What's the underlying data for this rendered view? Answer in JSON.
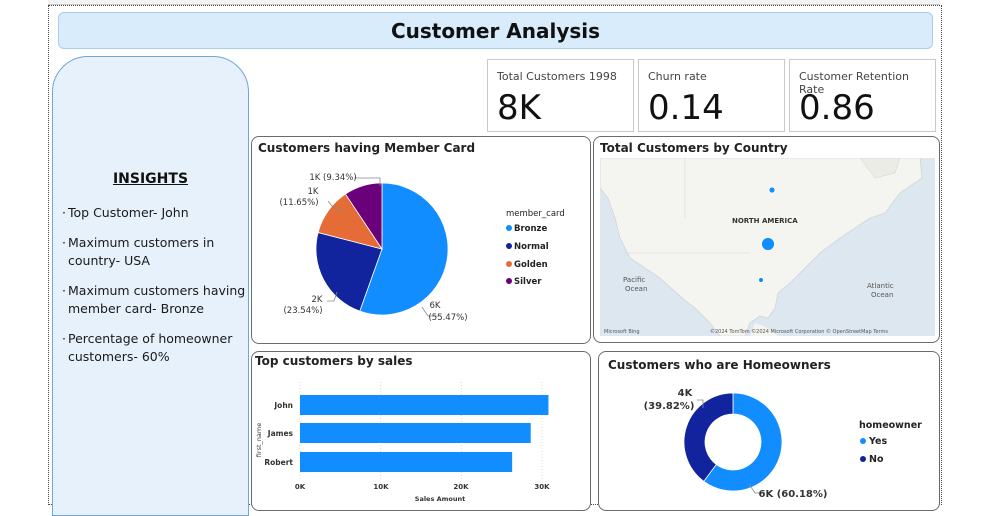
{
  "header": {
    "title": "Customer Analysis"
  },
  "insights": {
    "title": "INSIGHTS",
    "items": [
      "Top Customer- John",
      "Maximum customers in country- USA",
      "Maximum customers having member card- Bronze",
      "Percentage of homeowner customers- 60%"
    ]
  },
  "kpis": [
    {
      "label": "Total Customers 1998",
      "value": "8K"
    },
    {
      "label": "Churn rate",
      "value": "0.14"
    },
    {
      "label": "Customer Retention Rate",
      "value": "0.86"
    }
  ],
  "member_card_chart": {
    "title": "Customers having Member Card",
    "legend_title": "member_card",
    "legend": [
      "Bronze",
      "Normal",
      "Golden",
      "Silver"
    ],
    "labels": {
      "bronze": [
        "6K",
        "(55.47%)"
      ],
      "normal": [
        "2K",
        "(23.54%)"
      ],
      "golden": [
        "1K",
        "(11.65%)"
      ],
      "silver": [
        "1K (9.34%)"
      ]
    }
  },
  "map_card": {
    "title": "Total Customers by Country",
    "labels": {
      "continent": "NORTH AMERICA",
      "pacific": "Pacific",
      "pacific2": "Ocean",
      "atlantic": "Atlantic",
      "atlantic2": "Ocean"
    },
    "footer": {
      "brand": "Microsoft Bing",
      "copyright": "©2024 TomTom ©2024 Microsoft Corporation © OpenStreetMap Terms"
    }
  },
  "sales_chart": {
    "title": "Top customers by sales",
    "ylabel": "first_name",
    "xlabel": "Sales Amount",
    "ticks": [
      "0K",
      "10K",
      "20K",
      "30K"
    ]
  },
  "homeowner_chart": {
    "title": "Customers who are Homeowners",
    "legend_title": "homeowner",
    "legend": [
      "Yes",
      "No"
    ],
    "labels": {
      "no": [
        "4K",
        "(39.82%)"
      ],
      "yes": [
        "6K (60.18%)"
      ]
    }
  },
  "colors": {
    "bronze": "#118DFF",
    "normal": "#12239E",
    "golden": "#E66C37",
    "silver": "#6B007B",
    "bar": "#118DFF"
  },
  "chart_data": [
    {
      "type": "pie",
      "title": "Customers having Member Card",
      "legend_title": "member_card",
      "categories": [
        "Bronze",
        "Normal",
        "Golden",
        "Silver"
      ],
      "values": [
        55.47,
        23.54,
        11.65,
        9.34
      ]
    },
    {
      "type": "bar",
      "title": "Top customers by sales",
      "ylabel": "first_name",
      "xlabel": "Sales Amount",
      "categories": [
        "John",
        "James",
        "Robert"
      ],
      "values": [
        30800,
        28600,
        26300
      ],
      "xlim": [
        0,
        33000
      ]
    },
    {
      "type": "pie",
      "title": "Customers who are Homeowners",
      "legend_title": "homeowner",
      "categories": [
        "Yes",
        "No"
      ],
      "values": [
        60.18,
        39.82
      ]
    }
  ]
}
